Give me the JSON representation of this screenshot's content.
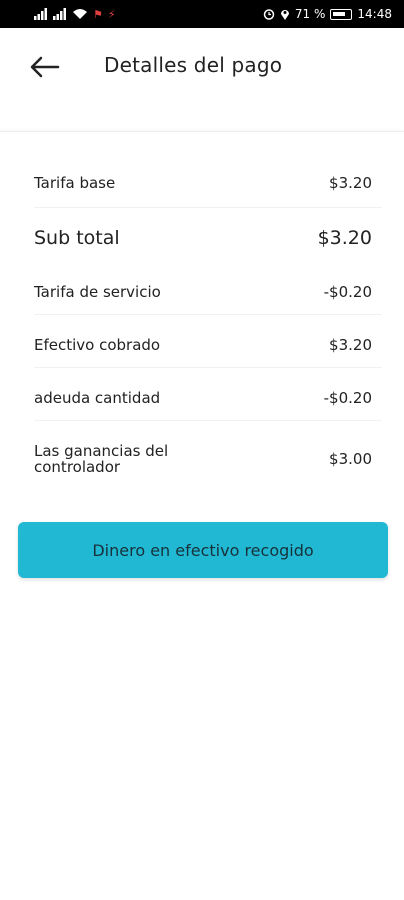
{
  "status_bar": {
    "battery_percent": "71 %",
    "time": "14:48"
  },
  "header": {
    "title": "Detalles del pago"
  },
  "details": [
    {
      "label": "Tarifa base",
      "value": "$3.20"
    },
    {
      "label": "Sub total",
      "value": "$3.20"
    },
    {
      "label": "Tarifa de servicio",
      "value": "-$0.20"
    },
    {
      "label": "Efectivo cobrado",
      "value": "$3.20"
    },
    {
      "label": "adeuda cantidad",
      "value": "-$0.20"
    },
    {
      "label_line1": "Las ganancias del",
      "label_line2": "controlador",
      "value": "$3.00"
    }
  ],
  "cta": {
    "label": "Dinero en efectivo recogido",
    "color": "#21b8d4"
  }
}
